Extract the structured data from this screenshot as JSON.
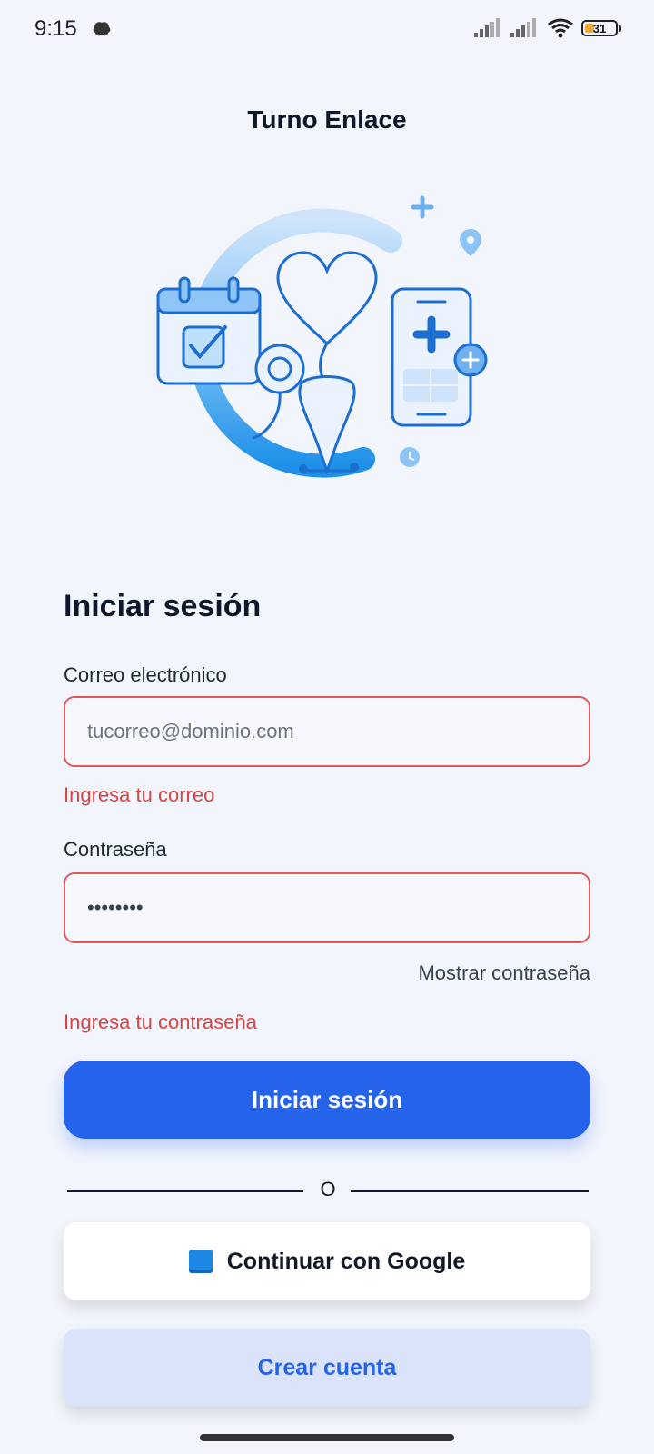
{
  "status_bar": {
    "time": "9:15",
    "battery_level": "31",
    "icons": [
      "notification-icon",
      "signal-icon",
      "signal-icon",
      "wifi-icon",
      "battery-icon"
    ]
  },
  "app": {
    "title": "Turno Enlace"
  },
  "hero": {
    "illustration": "medical-appointment-illustration"
  },
  "login": {
    "heading": "Iniciar sesión",
    "email": {
      "label": "Correo electrónico",
      "placeholder": "tucorreo@dominio.com",
      "value": "",
      "error": "Ingresa tu correo"
    },
    "password": {
      "label": "Contraseña",
      "value": "••••••••",
      "show_label": "Mostrar contraseña",
      "error": "Ingresa tu contraseña"
    },
    "submit_label": "Iniciar sesión",
    "divider_text": "O",
    "google_label": "Continuar con Google",
    "create_label": "Crear cuenta"
  },
  "colors": {
    "primary": "#2563eb",
    "error": "#d64545",
    "background": "#f2f5fc",
    "create_bg": "#dbe3fb"
  }
}
